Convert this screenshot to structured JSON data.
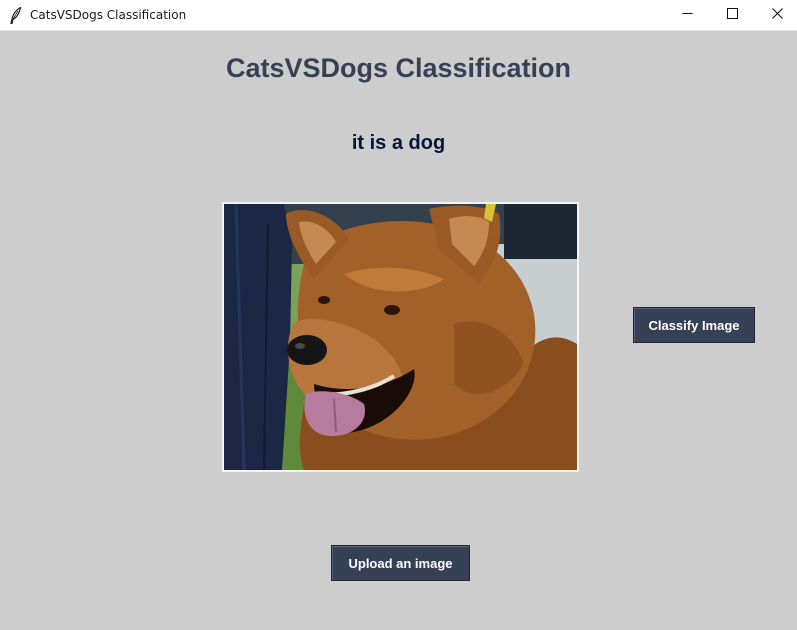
{
  "window": {
    "title": "CatsVSDogs Classification",
    "icon": "feather-icon",
    "controls": [
      "minimize-icon",
      "maximize-icon",
      "close-icon"
    ]
  },
  "main": {
    "heading": "CatsVSDogs Classification",
    "result": "it is a dog",
    "image": {
      "subject": "dog photo"
    },
    "classify_button": "Classify Image",
    "upload_button": "Upload an image"
  },
  "colors": {
    "background": "#cdcdcd",
    "heading": "#364156",
    "result": "#011638",
    "button": "#364156",
    "button_text": "#ffffff"
  }
}
